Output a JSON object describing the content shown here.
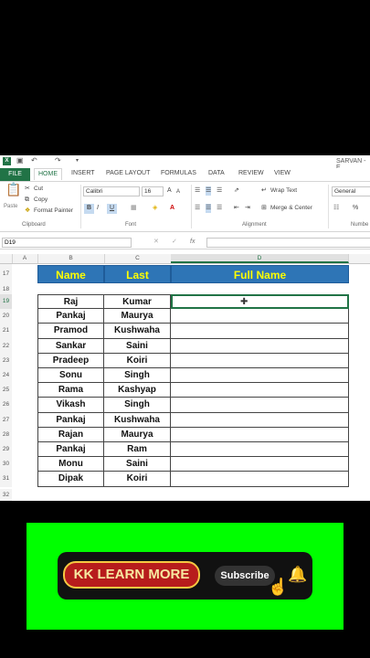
{
  "titlebar": {
    "right_text": "SARVAN - E"
  },
  "ribbon_tabs": [
    "FILE",
    "HOME",
    "INSERT",
    "PAGE LAYOUT",
    "FORMULAS",
    "DATA",
    "REVIEW",
    "VIEW"
  ],
  "clipboard": {
    "paste": "Paste",
    "cut": "Cut",
    "copy": "Copy",
    "format_painter": "Format Painter",
    "label": "Clipboard"
  },
  "font": {
    "name": "Calibri",
    "size": "16",
    "bold": "B",
    "italic": "I",
    "underline": "U",
    "grow": "A",
    "shrink": "A",
    "label": "Font"
  },
  "alignment": {
    "wrap_text": "Wrap Text",
    "merge_center": "Merge & Center",
    "label": "Alignment"
  },
  "number": {
    "format": "General",
    "percent": "%",
    "label": "Numbe"
  },
  "formula_bar": {
    "name_box": "D19",
    "fx": "fx",
    "value": ""
  },
  "columns": [
    "A",
    "B",
    "C",
    "D"
  ],
  "table": {
    "headers": {
      "name": "Name",
      "last": "Last",
      "full": "Full Name"
    },
    "rows": [
      {
        "row": "19",
        "name": "Raj",
        "last": "Kumar"
      },
      {
        "row": "20",
        "name": "Pankaj",
        "last": "Maurya"
      },
      {
        "row": "21",
        "name": "Pramod",
        "last": "Kushwaha"
      },
      {
        "row": "22",
        "name": "Sankar",
        "last": "Saini"
      },
      {
        "row": "23",
        "name": "Pradeep",
        "last": "Koiri"
      },
      {
        "row": "24",
        "name": "Sonu",
        "last": "Singh"
      },
      {
        "row": "25",
        "name": "Rama",
        "last": "Kashyap"
      },
      {
        "row": "26",
        "name": "Vikash",
        "last": "Singh"
      },
      {
        "row": "27",
        "name": "Pankaj",
        "last": "Kushwaha"
      },
      {
        "row": "28",
        "name": "Rajan",
        "last": "Maurya"
      },
      {
        "row": "29",
        "name": "Pankaj",
        "last": "Ram"
      },
      {
        "row": "30",
        "name": "Monu",
        "last": "Saini"
      },
      {
        "row": "31",
        "name": "Dipak",
        "last": "Koiri"
      }
    ],
    "row_numbers": {
      "r17": "17",
      "r18": "18",
      "r32": "32"
    }
  },
  "banner": {
    "channel": "KK LEARN MORE",
    "subscribe": "Subscribe"
  },
  "colors": {
    "excel_green": "#217346",
    "header_blue": "#2e75b6",
    "header_text": "#ffff00",
    "banner_green": "#00ff00"
  }
}
